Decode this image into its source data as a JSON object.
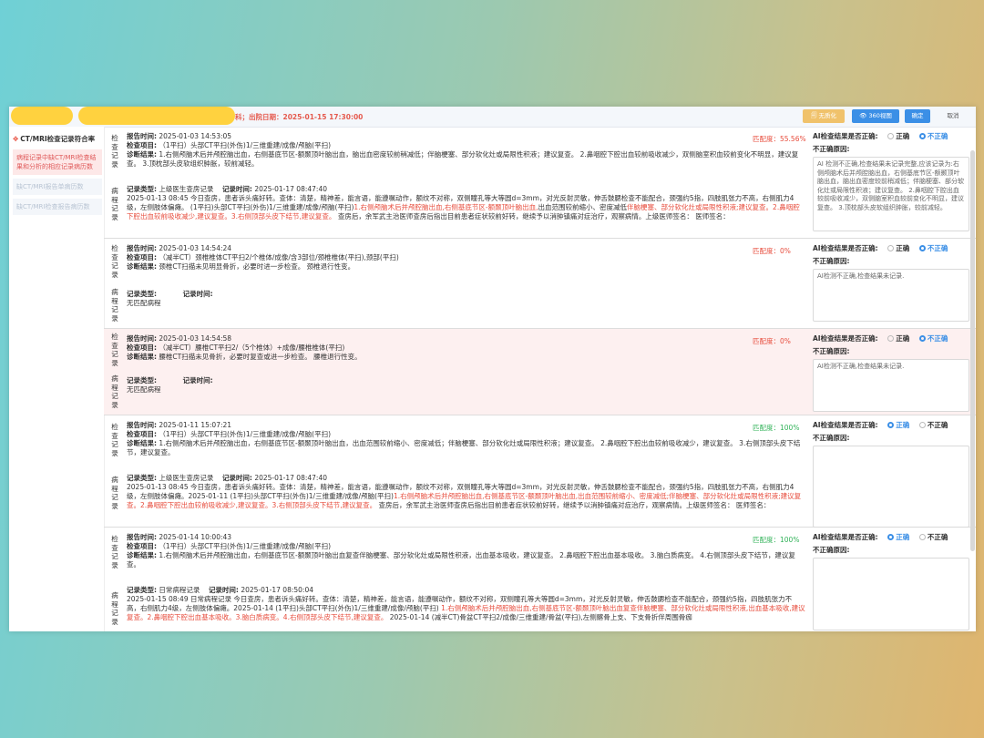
{
  "header": {
    "info": "科；出院日期：2025-01-15 17:30:00",
    "btn_structure": "🗐 无质化",
    "btn_view": "👁 360视图",
    "btn_confirm": "确定",
    "btn_cancel": "取消"
  },
  "sidebar": {
    "title": "CT/MRI检查记录符合率",
    "items": [
      "病程记录中缺CT/MRI检查结果和分析的相应记录病历数",
      "缺CT/MRI报告单病历数",
      "缺CT/MRI检查报告病历数"
    ]
  },
  "labels": {
    "check_record": "检查记录",
    "course_record": "病程记录",
    "report_time": "报告时间:",
    "check_item": "检查项目:",
    "diagnosis": "诊断结果:",
    "record_type": "记录类型:",
    "record_time": "记录时间:",
    "ai_question": "AI检查结果是否正确:",
    "correct": "正确",
    "incorrect": "不正确",
    "wrong_reason": "不正确原因:",
    "match_prefix": "匹配度："
  },
  "rows": [
    {
      "report_time": "2025-01-03 14:53:05",
      "item": "（1平扫）头部CT平扫(外伤)1/三维重建/成像/颅脑(平扫)",
      "diag": "1.右侧颅脑术后并颅腔脑出血，右侧基底节区-额颞顶叶脑出血，脑出血密度较前稍减低；伴脑梗塞、部分软化灶或局限性积液；建议复查。 2.鼻咽腔下腔出血较前吸收减少，双侧脑室积血较前变化不明显，建议复查。 3.顶枕部头皮软组织肿胀，较前减轻。",
      "match": "55.56%",
      "ai_answer": "incorrect",
      "reason": "AI 检测不正确,检查结果未记录完整,应该记录为:右侧颅脑术后并颅腔脑出血，右侧基底节区-额颞顶叶脑出血，脑出血密度较前稍减低；伴脑梗塞、部分软化灶或局限性积液；建议复查。 2.鼻咽腔下腔出血较前吸收减少，双侧脑室积血较前变化不明显，建议复查。 3.顶枕部头皮软组织肿胀，较前减轻。",
      "course": {
        "type": "上级医生查房记录",
        "time": "2025-01-17 08:47:40",
        "text_a": "2025-01-13 08:45",
        "text_b": "今日查房，患者诉头痛好转。查体：清楚，精神差，能言语，能遵嘱动作，额纹不对称，双侧瞳孔等大等圆d=3mm，对光反射灵敏，伸舌鼓腮检查不能配合，颈强约5指，四肢肌张力不高，右侧肌力4级，左侧肢体偏瘫。",
        "text_c": "(1平扫)头部CT平扫(外伤)1/三维重建/成像/颅脑(平扫)",
        "red_1": "1.右侧颅脑术后并颅腔脑出血,右侧基底节区-额颞顶叶脑出血,",
        "text_d": "出血范围较前缩小、密度减低",
        "red_2": "伴脑梗塞、部分软化灶或局限性积液;建议复查。2.鼻咽腔下腔出血较前吸收减少,建议复查。3.右侧顶部头皮下结节,建议复查。",
        "text_e": "查房后，余军武主治医师查房后指出目前患者症状较前好转，继续予以消肿镇痛对症治疗，观察病情。上级医师签名：",
        "sign": "医师签名："
      }
    },
    {
      "report_time": "2025-01-03 14:54:24",
      "item": "（减半CT）颈椎椎体CT平扫2/个椎体/成像/含3部位/颈椎椎体(平扫),颈部(平扫)",
      "diag": "颈椎CT扫描未见明显骨折，必要时进一步检查。 颈椎退行性变。",
      "match": "0%",
      "ai_answer": "incorrect",
      "reason": "AI检测不正确,检查结果未记录.",
      "course": {
        "type": "",
        "time": "",
        "none": "无匹配病程"
      }
    },
    {
      "report_time": "2025-01-03 14:54:58",
      "item": "（减半CT）腰椎CT平扫2/（5个椎体）+成像/腰椎椎体(平扫)",
      "diag": "腰椎CT扫描未见骨折，必要时复查或进一步检查。 腰椎退行性变。",
      "match": "0%",
      "ai_answer": "incorrect",
      "reason": "AI检测不正确,检查结果未记录.",
      "course": {
        "type": "",
        "time": "",
        "none": "无匹配病程"
      }
    },
    {
      "report_time": "2025-01-11 15:07:21",
      "item": "（1平扫）头部CT平扫(外伤)1/三维重建/成像/颅脑(平扫)",
      "diag": "1.右侧颅脑术后并颅腔脑出血，右侧基底节区-额颞顶叶脑出血，出血范围较前缩小、密度减低；伴脑梗塞、部分软化灶或局限性积液；建议复查。 2.鼻咽腔下腔出血较前吸收减少，建议复查。 3.右侧顶部头皮下结节，建议复查。",
      "match": "100%",
      "ai_answer": "correct",
      "reason": "",
      "course": {
        "type": "上级医生查房记录",
        "time": "2025-01-17 08:47:40",
        "text_a": "2025-01-13 08:45",
        "text_b": "今日查房，患者诉头痛好转。查体：清楚，精神差，能言语，能遵嘱动作，额纹不对称，双侧瞳孔等大等圆d=3mm，对光反射灵敏，伸舌鼓腮检查不能配合，颈强约5指，四肢肌张力不高，右侧肌力4级，左侧肢体偏瘫。2025-01-11",
        "text_c": "(1平扫)头部CT平扫(外伤)1/三维重建/成像/颅脑(平扫)",
        "red_1": "1.右侧颅脑术后并颅腔脑出血,右侧基底节区-额颞顶叶脑出血,出血范围较前缩小、密度减低;伴脑梗塞、部分软化灶或局限性积液;建议复查。",
        "text_d": "",
        "red_2": "2.鼻咽腔下腔出血较前吸收减少,建议复查。3.右侧顶部头皮下结节,建议复查。",
        "text_e": "查房后，余军武主治医师查房后指出目前患者症状较前好转，继续予以消肿镇痛对症治疗，观察病情。上级医师签名：",
        "sign": "医师签名："
      }
    },
    {
      "report_time": "2025-01-14 10:00:43",
      "item": "（1平扫）头部CT平扫(外伤)1/三维重建/成像/颅脑(平扫)",
      "diag": "1.右侧颅脑术后并颅腔脑出血，右侧基底节区-额颞顶叶脑出血复查伴脑梗塞、部分软化灶或局限性积液，出血基本吸收，建议复查。 2.鼻咽腔下腔出血基本吸收。 3.脑白质病变。 4.右侧顶部头皮下结节，建议复查。",
      "match": "100%",
      "ai_answer": "correct",
      "reason": "",
      "course": {
        "type": "日常病程记录",
        "time": "2025-01-17 08:50:04",
        "text_a": "2025-01-15 08:49",
        "text_b": "日常病程记录 今日查房，患者诉头痛好转。查体：清楚，精神差，能言语，能遵嘱动作，额纹不对称，双侧瞳孔等大等圆d=3mm，对光反射灵敏，伸舌鼓腮检查不能配合，颈强约5指，四肢肌张力不高，右侧肌力4级，左侧肢体偏瘫。2025-01-14 (1平扫)头部CT平扫(外伤)1/三维重建/成像/颅脑(平扫)",
        "text_c": "",
        "red_1": "1.右侧颅脑术后并颅腔脑出血,右侧基底节区-额颞顶叶脑出血复查伴脑梗塞、部分软化灶或局限性积液,出血基本吸收,建议复查。2.鼻咽腔下腔出血基本吸收。3.脑白质病变。4.右侧顶部头皮下结节,建议复查。",
        "text_d": "",
        "red_2": "",
        "text_e": "2025-01-14 (减半CT)骨盆CT平扫2/成像/三维重建/骨盆(平扫),左侧髂骨上支、下支骨折伴周围骨痂",
        "sign": ""
      }
    }
  ],
  "colors": {
    "accent": "#3b8fe6",
    "red": "#e74c3c",
    "green": "#33b35a",
    "pink_row": "#fdf0f0"
  }
}
